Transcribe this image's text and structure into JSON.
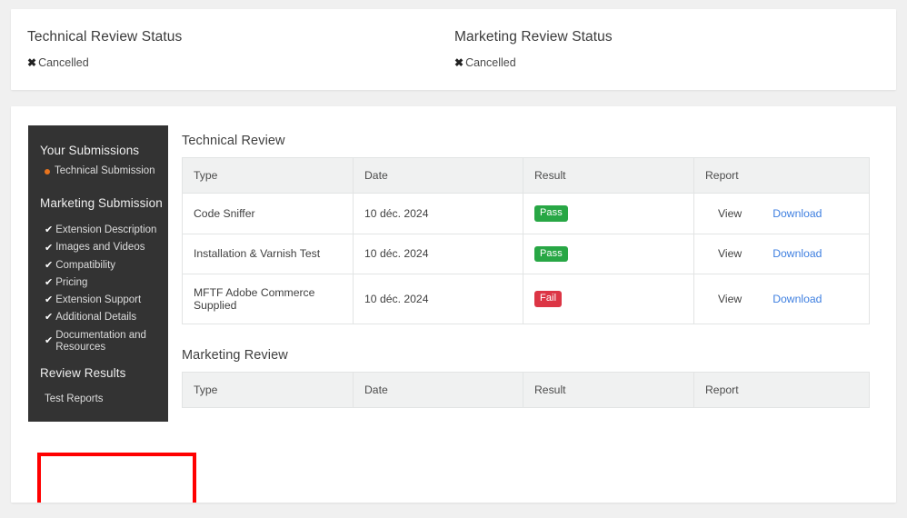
{
  "status_cards": [
    {
      "title": "Technical Review Status",
      "icon": "x-mark-icon",
      "value": "Cancelled"
    },
    {
      "title": "Marketing Review Status",
      "icon": "x-mark-icon",
      "value": "Cancelled"
    }
  ],
  "sidebar": {
    "headings": {
      "your_submissions": "Your Submissions",
      "marketing_submission": "Marketing Submission",
      "review_results": "Review Results"
    },
    "technical_items": [
      {
        "label": "Technical Submission",
        "icon": "orange-dot-icon"
      }
    ],
    "marketing_items": [
      {
        "label": "Extension Description",
        "icon": "check-icon"
      },
      {
        "label": "Images and Videos",
        "icon": "check-icon"
      },
      {
        "label": "Compatibility",
        "icon": "check-icon"
      },
      {
        "label": "Pricing",
        "icon": "check-icon"
      },
      {
        "label": "Extension Support",
        "icon": "check-icon"
      },
      {
        "label": "Additional Details",
        "icon": "check-icon"
      },
      {
        "label": "Documentation and Resources",
        "icon": "check-icon"
      }
    ],
    "review_items": [
      {
        "label": "Test Reports"
      }
    ],
    "highlight_color": "#ff0000"
  },
  "technical_review": {
    "title": "Technical Review",
    "columns": [
      "Type",
      "Date",
      "Result",
      "Report"
    ],
    "rows": [
      {
        "type": "Code Sniffer",
        "date": "10 déc. 2024",
        "result": "Pass",
        "result_state": "pass",
        "view": "View",
        "download": "Download"
      },
      {
        "type": "Installation & Varnish Test",
        "date": "10 déc. 2024",
        "result": "Pass",
        "result_state": "pass",
        "view": "View",
        "download": "Download"
      },
      {
        "type": "MFTF Adobe Commerce Supplied",
        "date": "10 déc. 2024",
        "result": "Fail",
        "result_state": "fail",
        "view": "View",
        "download": "Download"
      }
    ]
  },
  "marketing_review": {
    "title": "Marketing Review",
    "columns": [
      "Type",
      "Date",
      "Result",
      "Report"
    ],
    "rows": []
  },
  "colors": {
    "pass_badge": "#28a745",
    "fail_badge": "#dc3545",
    "download_link": "#3e7fe0",
    "sidebar_bg": "#333333",
    "accent_dot": "#e8741e",
    "page_bg": "#f0f0f0"
  }
}
